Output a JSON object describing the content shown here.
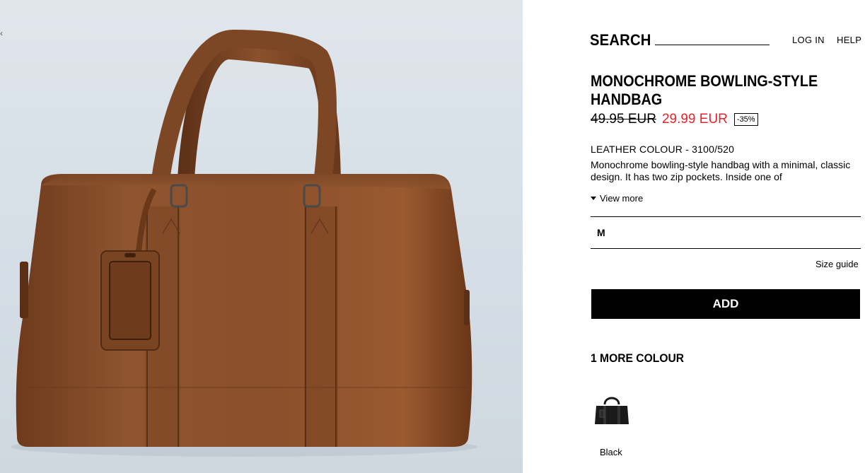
{
  "header": {
    "search_label": "SEARCH",
    "login_label": "LOG IN",
    "help_label": "HELP"
  },
  "product": {
    "title": "MONOCHROME BOWLING-STYLE HANDBAG",
    "old_price": "49.95 EUR",
    "new_price": "29.99 EUR",
    "discount": "-35%",
    "colour_line": "LEATHER COLOUR - 3100/520",
    "description": "Monochrome bowling-style handbag with a minimal, classic design. It has two zip pockets. Inside one of",
    "view_more_label": "View more",
    "selected_size": "M",
    "size_guide_label": "Size guide",
    "add_label": "ADD"
  },
  "colours": {
    "heading": "1 MORE COLOUR",
    "options": [
      {
        "label": "Black",
        "swatch_color": "#1a1a1a"
      }
    ]
  },
  "image": {
    "bag_color": "#8a4f2a",
    "background_color": "#d8e0e7",
    "edge_mark": "‹"
  },
  "colors": {
    "sale_price": "#e0262c",
    "button_bg": "#000000",
    "button_text": "#ffffff"
  }
}
